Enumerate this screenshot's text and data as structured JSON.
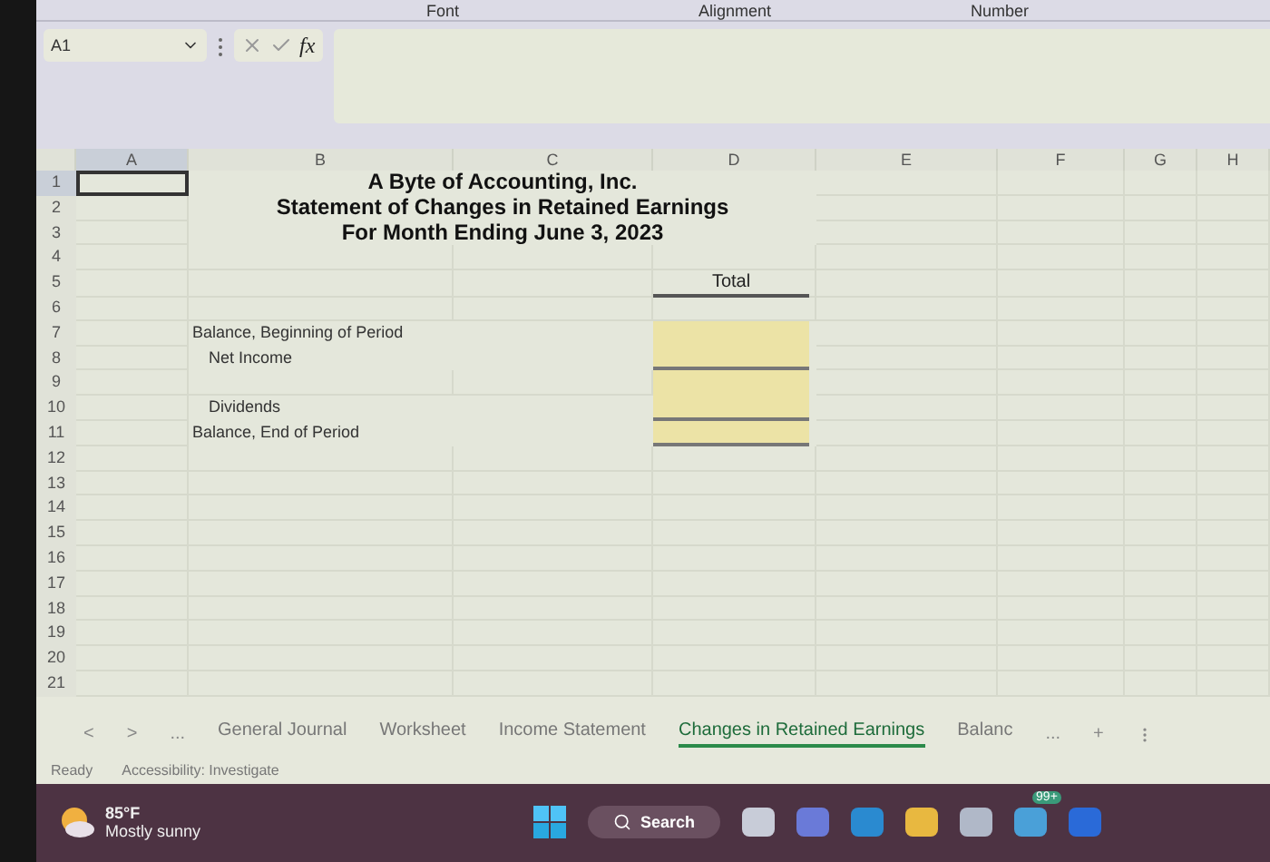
{
  "ribbon_groups": [
    "Font",
    "Alignment",
    "Number"
  ],
  "formula_bar": {
    "name_box": "A1",
    "function_label": "fx"
  },
  "columns": [
    "A",
    "B",
    "C",
    "D",
    "E",
    "F",
    "G",
    "H"
  ],
  "rows": [
    {
      "number": "1",
      "kind": "title",
      "text": "A Byte of Accounting, Inc.",
      "selected": true
    },
    {
      "number": "2",
      "kind": "title",
      "text": "Statement of Changes in Retained Earnings",
      "selected": false
    },
    {
      "number": "3",
      "kind": "title",
      "text": "For Month Ending June 3, 2023",
      "selected": false
    },
    {
      "number": "4",
      "kind": "blank",
      "selected": false
    },
    {
      "number": "5",
      "kind": "header",
      "text": "Total",
      "selected": false
    },
    {
      "number": "6",
      "kind": "blank",
      "selected": false
    },
    {
      "number": "7",
      "kind": "line",
      "text": "Balance, Beginning of Period",
      "indented": false,
      "underlined": false,
      "selected": false
    },
    {
      "number": "8",
      "kind": "line",
      "text": "Net Income",
      "indented": true,
      "underlined": true,
      "selected": false
    },
    {
      "number": "9",
      "kind": "line",
      "underlined": false,
      "selected": false
    },
    {
      "number": "10",
      "kind": "line",
      "text": "Dividends",
      "indented": true,
      "underlined": true,
      "selected": false
    },
    {
      "number": "11",
      "kind": "line",
      "text": "Balance, End of Period",
      "indented": false,
      "underlined": true,
      "selected": false
    },
    {
      "number": "12",
      "kind": "blank",
      "selected": false
    },
    {
      "number": "13",
      "kind": "blank",
      "selected": false
    },
    {
      "number": "14",
      "kind": "blank",
      "selected": false
    },
    {
      "number": "15",
      "kind": "blank",
      "selected": false
    },
    {
      "number": "16",
      "kind": "blank",
      "selected": false
    },
    {
      "number": "17",
      "kind": "blank",
      "selected": false
    },
    {
      "number": "18",
      "kind": "blank",
      "selected": false
    },
    {
      "number": "19",
      "kind": "blank",
      "selected": false
    },
    {
      "number": "20",
      "kind": "blank",
      "selected": false
    },
    {
      "number": "21",
      "kind": "blank",
      "selected": false
    }
  ],
  "sheet_tabs": {
    "nav": [
      "<",
      ">",
      "..."
    ],
    "tabs": [
      {
        "label": "General Journal",
        "selected": false
      },
      {
        "label": "Worksheet",
        "selected": false
      },
      {
        "label": "Income Statement",
        "selected": false
      },
      {
        "label": "Changes in Retained Earnings",
        "selected": true
      },
      {
        "label": "Balanc",
        "selected": false
      }
    ],
    "more": "...",
    "add": "+"
  },
  "status_bar": {
    "mode": "Ready",
    "accessibility": "Accessibility: Investigate"
  },
  "taskbar": {
    "temperature": "85°F",
    "weather": "Mostly sunny",
    "search": "Search",
    "badge": "99+"
  }
}
